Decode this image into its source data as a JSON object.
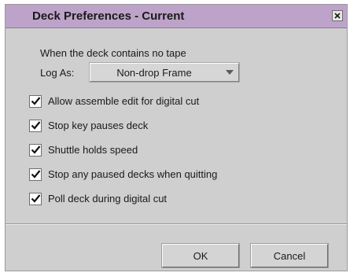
{
  "window": {
    "title": "Deck Preferences - Current",
    "close_symbol": "x"
  },
  "no_tape": {
    "caption": "When the deck contains no tape",
    "log_as_label": "Log As:",
    "log_as_value": "Non-drop Frame"
  },
  "options": [
    {
      "label": "Allow assemble edit for digital cut",
      "checked": true
    },
    {
      "label": "Stop key pauses deck",
      "checked": true
    },
    {
      "label": "Shuttle holds speed",
      "checked": true
    },
    {
      "label": "Stop any paused decks when quitting",
      "checked": true
    },
    {
      "label": "Poll deck during digital cut",
      "checked": true
    }
  ],
  "buttons": {
    "ok_label": "OK",
    "cancel_label": "Cancel"
  },
  "icons": {
    "close": "close-icon",
    "dropdown": "chevron-down-icon",
    "check": "checkmark-icon"
  },
  "colors": {
    "titlebar": "#bda3c9",
    "dialog_bg": "#cfcfcf"
  }
}
